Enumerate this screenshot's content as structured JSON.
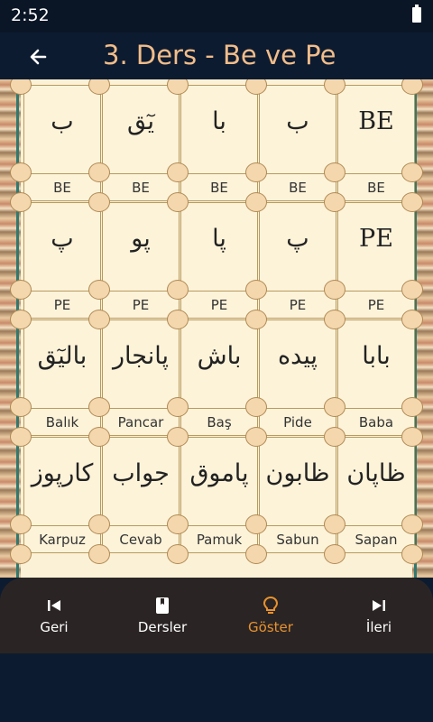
{
  "status": {
    "time": "2:52"
  },
  "appbar": {
    "title": "3. Ders - Be ve Pe"
  },
  "rows": [
    [
      {
        "ar": "ب",
        "cap": "BE"
      },
      {
        "ar": "يٓق",
        "cap": "BE"
      },
      {
        "ar": "با",
        "cap": "BE"
      },
      {
        "ar": "ب",
        "cap": "BE"
      },
      {
        "ar": "BE",
        "cap": "BE",
        "latin": true
      }
    ],
    [
      {
        "ar": "پ",
        "cap": "PE"
      },
      {
        "ar": "پو",
        "cap": "PE"
      },
      {
        "ar": "پا",
        "cap": "PE"
      },
      {
        "ar": "پ",
        "cap": "PE"
      },
      {
        "ar": "PE",
        "cap": "PE",
        "latin": true
      }
    ],
    [
      {
        "ar": "بالیٓق",
        "cap": "Balık"
      },
      {
        "ar": "پانجار",
        "cap": "Pancar"
      },
      {
        "ar": "باش",
        "cap": "Baş"
      },
      {
        "ar": "پیده",
        "cap": "Pide"
      },
      {
        "ar": "بابا",
        "cap": "Baba"
      }
    ],
    [
      {
        "ar": "كارپوز",
        "cap": "Karpuz"
      },
      {
        "ar": "جواب",
        "cap": "Cevab"
      },
      {
        "ar": "پاموق",
        "cap": "Pamuk"
      },
      {
        "ar": "ظابون",
        "cap": "Sabun"
      },
      {
        "ar": "ظاپان",
        "cap": "Sapan"
      }
    ]
  ],
  "nav": {
    "items": [
      {
        "label": "Geri",
        "icon": "skip-previous-icon"
      },
      {
        "label": "Dersler",
        "icon": "book-icon"
      },
      {
        "label": "Göster",
        "icon": "lightbulb-icon",
        "active": true
      },
      {
        "label": "İleri",
        "icon": "skip-next-icon"
      }
    ],
    "active_color": "#e8922f"
  }
}
